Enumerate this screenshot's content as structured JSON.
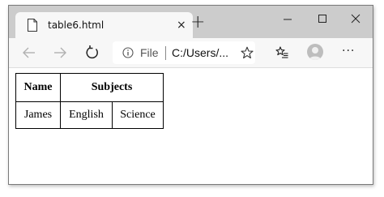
{
  "browser": {
    "tab_title": "table6.html",
    "tab_close": "×",
    "new_tab": "+",
    "address": {
      "scheme_label": "File",
      "url_text": "C:/Users/..."
    },
    "menu": "···"
  },
  "table": {
    "headers": [
      "Name",
      "Subjects"
    ],
    "rows": [
      [
        "James",
        "English",
        "Science"
      ]
    ]
  },
  "icons": {
    "page": "page-icon",
    "minimize": "minimize-icon",
    "maximize": "maximize-icon",
    "close": "close-icon",
    "back": "back-arrow-icon",
    "forward": "forward-arrow-icon",
    "reload": "reload-icon",
    "info": "info-icon",
    "favorite": "star-icon",
    "favorites_list": "favorites-list-icon",
    "profile": "profile-avatar-icon",
    "menu": "more-icon"
  }
}
